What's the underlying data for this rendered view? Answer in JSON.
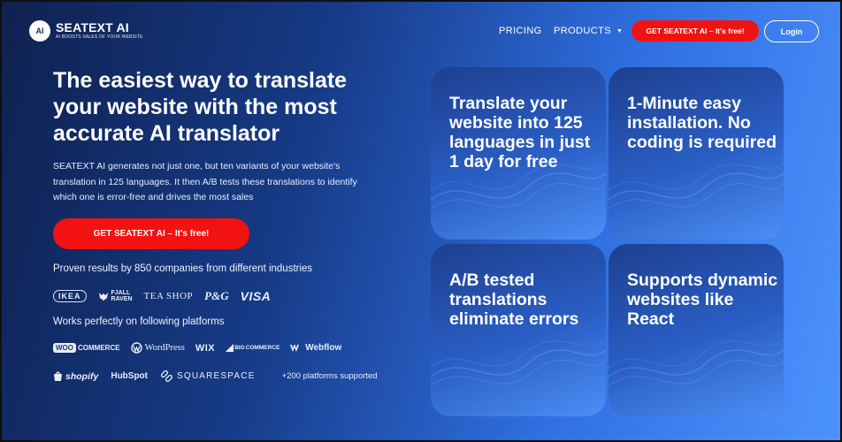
{
  "colors": {
    "accent_red": "#f21212",
    "bg_dark": "#0f2150",
    "bg_light": "#4d93ff"
  },
  "header": {
    "logo_badge": "AI",
    "logo_name": "SEATEXT AI",
    "logo_tagline": "AI BOOSTS SALES OF YOUR WEBSITE",
    "nav": {
      "pricing": "PRICING",
      "products": "PRODUCTS"
    },
    "cta": "GET SEATEXT AI – It's free!",
    "login": "Login"
  },
  "hero": {
    "title": "The easiest way to translate your website with the most accurate AI translator",
    "description": "SEATEXT AI generates not just one, but ten variants of your website's translation in 125 languages. It then A/B tests these translations to identify which one is error-free and drives the most sales",
    "cta": "GET SEATEXT AI – It's free!",
    "proven": "Proven results by 850 companies from different industries",
    "works": "Works perfectly on following platforms"
  },
  "brands": {
    "ikea": "IKEA",
    "fjall_top": "FJALL",
    "fjall_bottom": "RAVEN",
    "teashop": "TEA SHOP",
    "pg": "P&G",
    "visa": "VISA"
  },
  "platforms": {
    "woo_badge": "WOO",
    "woo_rest": "COMMERCE",
    "wordpress": "WordPress",
    "wix": "WIX",
    "big_badge": "BIG",
    "big_rest": "COMMERCE",
    "webflow": "Webflow",
    "shopify": "shopify",
    "hubspot": "HubSpot",
    "squarespace": "SQUARESPACE",
    "more": "+200 platforms supported"
  },
  "cards": [
    {
      "text": "Translate your website into 125 languages in just 1 day for free"
    },
    {
      "text": "1-Minute easy installation. No coding is required"
    },
    {
      "text": "A/B tested translations eliminate errors"
    },
    {
      "text": "Supports dynamic websites like React"
    }
  ]
}
